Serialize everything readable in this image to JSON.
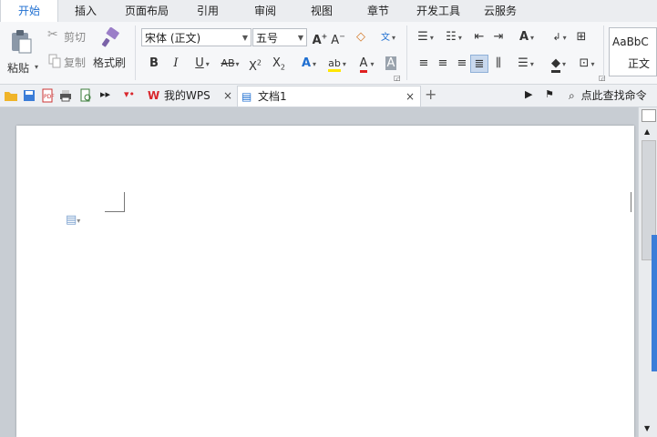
{
  "menu": {
    "tabs": [
      {
        "label": "开始",
        "active": true
      },
      {
        "label": "插入"
      },
      {
        "label": "页面布局"
      },
      {
        "label": "引用"
      },
      {
        "label": "审阅"
      },
      {
        "label": "视图"
      },
      {
        "label": "章节"
      },
      {
        "label": "开发工具"
      },
      {
        "label": "云服务"
      }
    ]
  },
  "ribbon": {
    "paste_label": "粘贴",
    "cut_label": "剪切",
    "copy_label": "复制",
    "format_painter_label": "格式刷",
    "font_name": "宋体 (正文)",
    "font_size": "五号",
    "style_preview_text": "AaBbC",
    "style_name": "正文"
  },
  "doc_tabs": {
    "wps_tab_label": "我的WPS",
    "doc_tab_label": "文档1",
    "search_command_label": "点此查找命令"
  },
  "colors": {
    "accent": "#1f6fd1",
    "wps_red": "#d9262c",
    "highlight_yellow": "#ffe600",
    "font_red": "#e02020"
  }
}
